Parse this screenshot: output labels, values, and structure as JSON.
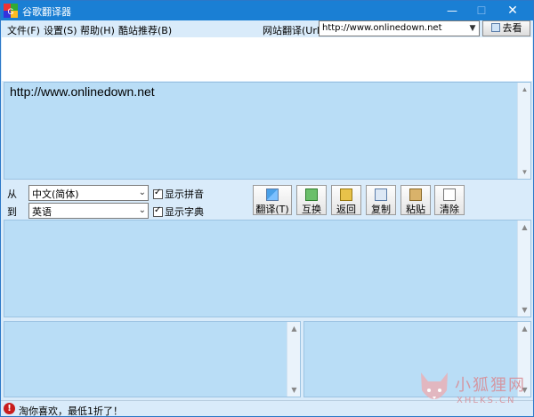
{
  "window": {
    "title": "谷歌翻译器",
    "min_glyph": "—",
    "max_glyph": "☐",
    "close_glyph": "✕"
  },
  "menu": {
    "items": [
      "文件(F)",
      "设置(S)",
      "帮助(H)",
      "酷站推荐(B)"
    ],
    "url_label": "网站翻译(Url)",
    "url_value": "http://www.onlinedown.net",
    "go_label": "去看"
  },
  "source": {
    "text": "http://www.onlinedown.net"
  },
  "controls": {
    "from_label": "从",
    "to_label": "到",
    "from_lang": "中文(简体)",
    "to_lang": "英语",
    "show_pinyin": "显示拼音",
    "show_dict": "显示字典",
    "pinyin_checked": true,
    "dict_checked": true
  },
  "toolbar": {
    "translate": "翻译(T)",
    "swap": "互换",
    "back": "返回",
    "copy": "复制",
    "paste": "粘贴",
    "clear": "清除"
  },
  "status": {
    "icon_glyph": "!",
    "text": "淘你喜欢，最低1折了！"
  },
  "watermark": {
    "title": "小狐狸网",
    "subtitle": "XHLKS.CN"
  },
  "colors": {
    "titlebar": "#1a7fd4",
    "panel": "#b9ddf6",
    "background": "#d9ebfa"
  }
}
